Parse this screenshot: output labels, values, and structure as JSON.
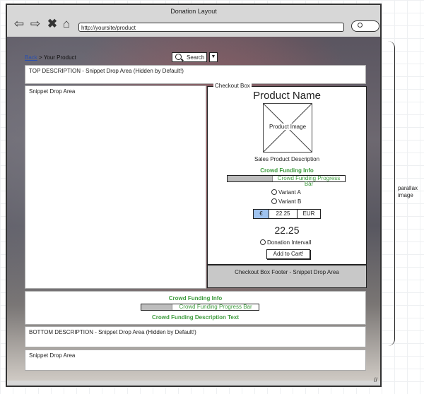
{
  "window": {
    "title": "Donation Layout",
    "url": "http://yoursite/product"
  },
  "icons": [
    "back-arrow-icon",
    "forward-arrow-icon",
    "close-icon",
    "home-icon",
    "search-icon"
  ],
  "breadcrumb": {
    "back": "Back",
    "current": "Your Product"
  },
  "search": {
    "label": "Search"
  },
  "top_description": "TOP DESCRIPTION - Snippet Drop Area (Hidden by Default!)",
  "left_snippet": "Snippet Drop Area",
  "checkout": {
    "legend": "Checkout Box",
    "product_name": "Product Name",
    "image_label": "Product Image",
    "sales_description": "Sales Product Description",
    "crowd_info": "Crowd Funding Info",
    "progress_label": "Crowd Funding Progress Bar",
    "progress_value": 0.38,
    "variant_a": "Variant A",
    "variant_b": "Variant B",
    "currency_symbol": "€",
    "amount": "22.25",
    "currency_code": "EUR",
    "price": "22.25",
    "donation_interval": "Donation Intervall",
    "add_to_cart": "Add to Cart!",
    "footer": "Checkout Box Footer - Snippet Drop Area"
  },
  "crowd_section": {
    "info": "Crowd Funding Info",
    "progress_label": "Crowd Funding Progress Bar",
    "progress_value": 0.26,
    "description": "Crowd Funding Description Text"
  },
  "bottom_description": "BOTTOM DESCRIPTION - Snippet Drop Area (Hidden by Default!)",
  "bottom_snippet": "Snippet Drop Area",
  "annotation": {
    "line1": "parallax",
    "line2": "image"
  },
  "colors": {
    "accent_green": "#3c9a3c",
    "currency_selected": "#9fc3ef",
    "link": "#2a4fb0"
  }
}
